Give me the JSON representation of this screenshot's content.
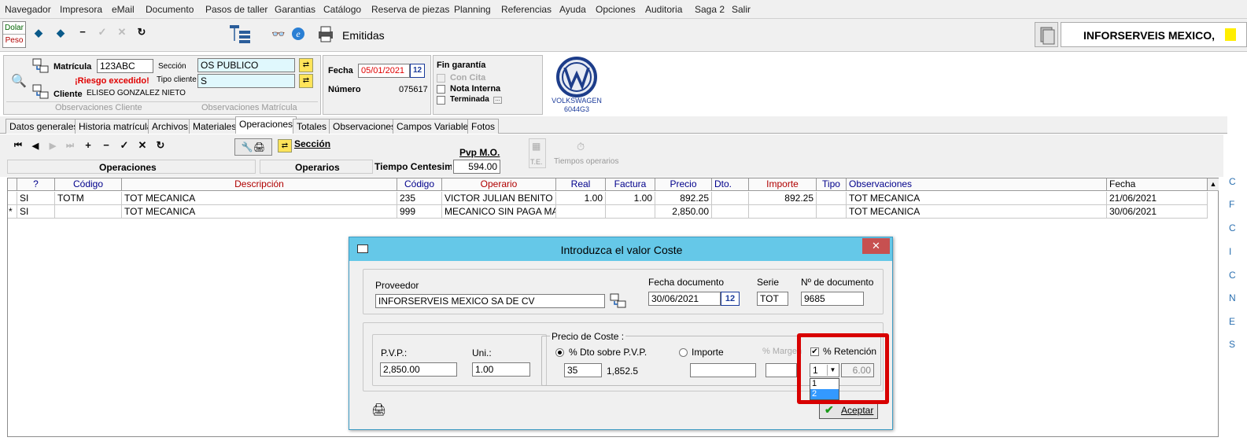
{
  "menu": [
    "Navegador",
    "Impresora",
    "eMail",
    "Documento",
    "Pasos de taller",
    "Garantias",
    "Catálogo",
    "Reserva de piezas",
    "Planning",
    "Referencias",
    "Ayuda",
    "Opciones",
    "Auditoria",
    "Saga 2",
    "Salir"
  ],
  "toolbar": {
    "currency_dolar": "Dolar",
    "currency_peso": "Peso",
    "mode_label": "Emitidas",
    "company": "INFORSERVEIS MEXICO,"
  },
  "header": {
    "matricula_label": "Matrícula",
    "matricula_value": "123ABC",
    "riesgo": "¡Riesgo excedido!",
    "cliente_label": "Cliente",
    "cliente_value": "ELISEO GONZALEZ NIETO",
    "seccion_label": "Sección",
    "seccion_value": "OS PUBLICO",
    "tipo_cliente_label": "Tipo cliente",
    "tipo_cliente_value": "S",
    "obs_cliente": "Observaciones  Cliente",
    "obs_matricula": "Observaciones  Matrícula",
    "fecha_label": "Fecha",
    "fecha_value": "05/01/2021",
    "calendar_glyph": "12",
    "numero_label": "Número",
    "numero_value": "075617",
    "fin_garantia": "Fin garantía",
    "con_cita": "Con Cita",
    "nota_interna": "Nota Interna",
    "terminada": "Terminada",
    "brand": "VOLKSWAGEN",
    "brand_code": "6044G3"
  },
  "tabs": [
    "Datos generales",
    "Historia matrícula",
    "Archivos",
    "Materiales",
    "Operaciones",
    "Totales",
    "Observaciones",
    "Campos Variables",
    "Fotos"
  ],
  "ops": {
    "seccion_link": "Sección",
    "pvp_mo_label": "Pvp M.O.",
    "pvp_mo_value": "594.00",
    "te_label": "T.E.",
    "tiempos_label": "Tiempos operarios",
    "col_operaciones": "Operaciones",
    "col_operarios": "Operarios",
    "tiempo_centesimal": "Tiempo Centesimal"
  },
  "grid": {
    "columns": [
      "?",
      "Código",
      "Descripción",
      "Código",
      "Operario",
      "Real",
      "Factura",
      "Precio",
      "Dto.",
      "Importe",
      "Tipo",
      "Observaciones",
      "Fecha"
    ],
    "rows": [
      {
        "marker": "",
        "q": "SI",
        "codigo": "TOTM",
        "descripcion": "TOT MECANICA",
        "codigo2": "235",
        "operario": "VICTOR JULIAN BENITO",
        "real": "1.00",
        "factura": "1.00",
        "precio": "892.25",
        "dto": "",
        "importe": "892.25",
        "tipo": "",
        "observaciones": "TOT MECANICA",
        "fecha": "21/06/2021"
      },
      {
        "marker": "*",
        "q": "SI",
        "codigo": "",
        "descripcion": "TOT MECANICA",
        "codigo2": "999",
        "operario": "MECANICO SIN PAGA MA",
        "real": "",
        "factura": "",
        "precio": "2,850.00",
        "dto": "",
        "importe": "",
        "tipo": "",
        "observaciones": "TOT MECANICA",
        "fecha": "30/06/2021"
      }
    ]
  },
  "side_letters": [
    "C",
    "F",
    "C",
    "I",
    "C",
    "N",
    "E",
    "S"
  ],
  "dialog": {
    "title": "Introduzca el valor Coste",
    "close": "✕",
    "proveedor_label": "Proveedor",
    "proveedor_value": "INFORSERVEIS MEXICO SA DE CV",
    "fecha_doc_label": "Fecha documento",
    "fecha_doc_value": "30/06/2021",
    "calendar_glyph": "12",
    "serie_label": "Serie",
    "serie_value": "TOT",
    "num_doc_label": "Nº de documento",
    "num_doc_value": "9685",
    "pvp_label": "P.V.P.:",
    "pvp_value": "2,850.00",
    "uni_label": "Uni.:",
    "uni_value": "1.00",
    "precio_coste_label": "Precio de Coste :",
    "dto_radio_label": "% Dto sobre  P.V.P.",
    "dto_value": "35",
    "dto_result": "1,852.5",
    "importe_radio_label": "Importe",
    "margen_label": "% Margen",
    "retencion_label": "% Retención",
    "retencion_select": "1",
    "retencion_value": "6.00",
    "dropdown_options": [
      "1",
      "2"
    ],
    "accept_label": "Aceptar",
    "highlight_color": "#d80000"
  }
}
